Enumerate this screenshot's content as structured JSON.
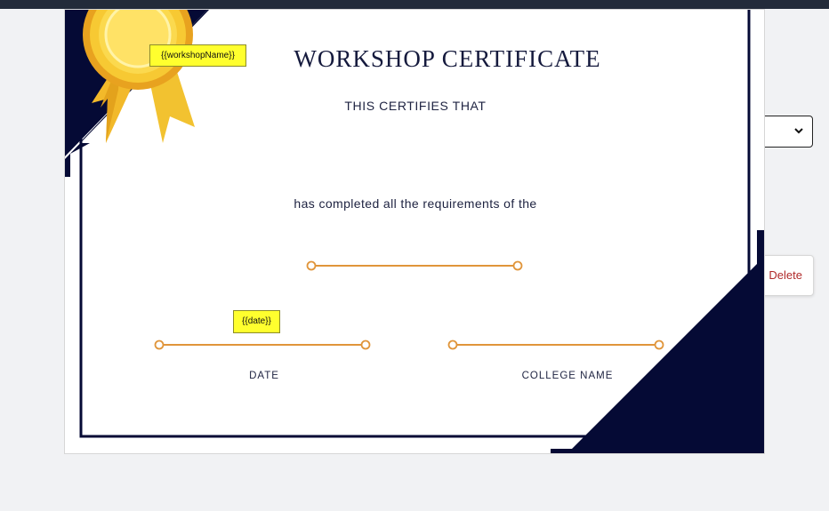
{
  "certificate": {
    "title": "WORKSHOP CERTIFICATE",
    "certifies": "THIS CERTIFIES THAT",
    "completed": "has completed all the requirements of the",
    "date_label": "DATE",
    "college_label": "COLLEGE NAME",
    "placeholders": {
      "workshop_name": "{{workshopName}}",
      "date": "{{date}}"
    }
  },
  "side_panel": {
    "select_value": "",
    "delete_label": "Delete"
  },
  "colors": {
    "navy": "#050a35",
    "gold": "#f2c230",
    "line": "#e0953a",
    "placeholder_bg": "#ffff2e",
    "delete_text": "#b02a2a"
  },
  "icons": [
    "ribbon-badge-icon",
    "chevron-down-icon"
  ]
}
